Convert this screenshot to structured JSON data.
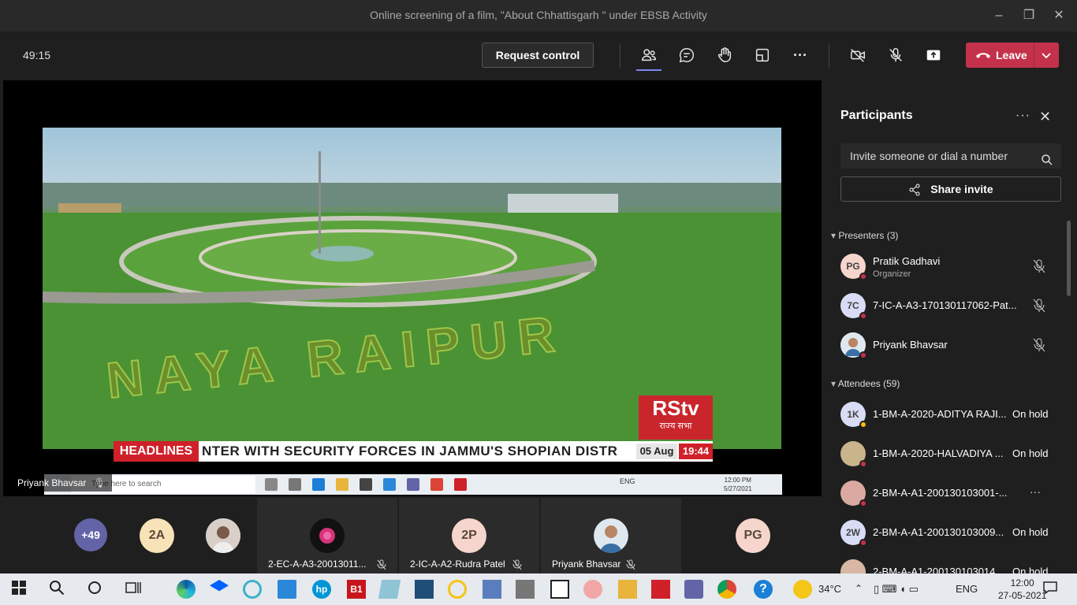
{
  "window": {
    "title": "Online screening of a film, \"About Chhattisgarh \" under EBSB Activity"
  },
  "toolbar": {
    "timer": "49:15",
    "request_control": "Request control",
    "leave_label": "Leave"
  },
  "video": {
    "ticker_tag": "HEADLINES",
    "ticker_text": "NTER WITH SECURITY FORCES IN JAMMU'S SHOPIAN DISTR",
    "ticker_date": "05 Aug",
    "ticker_time": "19:44",
    "channel_logo": "RStv",
    "channel_sub": "राज्य सभा",
    "shared_by": "Priyank Bhavsar",
    "inner_search_placeholder": "Type here to search",
    "inner_tray_lang": "ENG",
    "inner_clock_time": "12:00 PM",
    "inner_clock_date": "5/27/2021"
  },
  "panel": {
    "title": "Participants",
    "invite_placeholder": "Invite someone or dial a number",
    "share_invite": "Share invite",
    "presenters_header": "Presenters (3)",
    "attendees_header": "Attendees (59)",
    "presenters": [
      {
        "initials": "PG",
        "name": "Pratik Gadhavi",
        "role": "Organizer",
        "avatar_color": "#f5d5cc"
      },
      {
        "initials": "7C",
        "name": "7-IC-A-A3-170130117062-Pat...",
        "avatar_color": "#d8dcf5"
      },
      {
        "initials": "",
        "name": "Priyank Bhavsar",
        "avatar_color": "#6aa0c9"
      }
    ],
    "attendees": [
      {
        "initials": "1K",
        "name": "1-BM-A-2020-ADITYA RAJI...",
        "status": "On hold",
        "avatar_color": "#d8dcf5"
      },
      {
        "initials": "",
        "name": "1-BM-A-2020-HALVADIYA ...",
        "status": "On hold",
        "avatar_color": "#c9b48c"
      },
      {
        "initials": "",
        "name": "2-BM-A-A1-200130103001-...",
        "status": "",
        "avatar_color": "#d9a9a2"
      },
      {
        "initials": "2W",
        "name": "2-BM-A-A1-200130103009...",
        "status": "On hold",
        "avatar_color": "#d8dcf5"
      },
      {
        "initials": "",
        "name": "2-BM-A-A1-200130103014...",
        "status": "On hold",
        "avatar_color": "#d9b7a5"
      }
    ]
  },
  "gallery": {
    "overflow_count": "+49",
    "tiles": [
      {
        "initials": "2A",
        "label": ""
      },
      {
        "initials": "",
        "label": ""
      },
      {
        "initials": "",
        "label": "2-EC-A-A3-20013011..."
      },
      {
        "initials": "2P",
        "label": "2-IC-A-A2-Rudra Patel"
      },
      {
        "initials": "",
        "label": "Priyank Bhavsar"
      },
      {
        "initials": "PG",
        "label": ""
      }
    ]
  },
  "taskbar": {
    "weather": "34°C",
    "lang": "ENG",
    "time": "12:00",
    "date": "27-05-2021"
  },
  "colors": {
    "leave": "#c4314b",
    "accent": "#7f85f5",
    "busy": "#c4314b",
    "away": "#fcb714"
  }
}
